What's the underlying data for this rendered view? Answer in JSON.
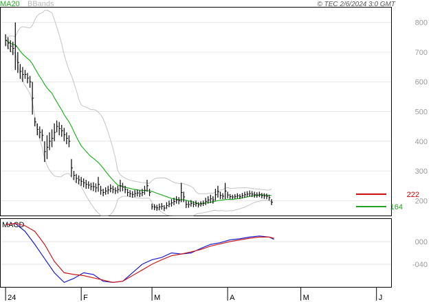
{
  "header": {
    "copyright": "© TEC 2/6/2024 3:0 GMT",
    "legend": [
      {
        "name": "MA20",
        "color": "#22b022"
      },
      {
        "name": "BBands",
        "color": "#b8b8b8"
      }
    ]
  },
  "chart_data": [
    {
      "type": "line",
      "panel": "price",
      "yticks": [
        "800",
        "700",
        "600",
        "500",
        "400",
        "300",
        "200"
      ],
      "ylim": [
        150,
        850
      ],
      "xticks": [
        {
          "label": "24",
          "day": 0
        },
        {
          "label": "F",
          "day": 31
        },
        {
          "label": "M",
          "day": 60
        },
        {
          "label": "A",
          "day": 91
        },
        {
          "label": "M",
          "day": 121
        },
        {
          "label": "J",
          "day": 152
        }
      ],
      "xlim": [
        -2,
        158
      ],
      "price_high_low": [
        {
          "day": 0,
          "high": 760,
          "low": 720
        },
        {
          "day": 1,
          "high": 750,
          "low": 710
        },
        {
          "day": 2,
          "high": 740,
          "low": 700
        },
        {
          "day": 3,
          "high": 735,
          "low": 690
        },
        {
          "day": 4,
          "high": 800,
          "low": 640
        },
        {
          "day": 5,
          "high": 700,
          "low": 630
        },
        {
          "day": 6,
          "high": 660,
          "low": 610
        },
        {
          "day": 7,
          "high": 650,
          "low": 600
        },
        {
          "day": 8,
          "high": 640,
          "low": 610
        },
        {
          "day": 9,
          "high": 630,
          "low": 595
        },
        {
          "day": 10,
          "high": 620,
          "low": 580
        },
        {
          "day": 11,
          "high": 600,
          "low": 490
        },
        {
          "day": 12,
          "high": 480,
          "low": 450
        },
        {
          "day": 13,
          "high": 460,
          "low": 420
        },
        {
          "day": 14,
          "high": 450,
          "low": 410
        },
        {
          "day": 15,
          "high": 440,
          "low": 400
        },
        {
          "day": 16,
          "high": 400,
          "low": 330
        },
        {
          "day": 17,
          "high": 420,
          "low": 340
        },
        {
          "day": 18,
          "high": 430,
          "low": 370
        },
        {
          "day": 19,
          "high": 440,
          "low": 380
        },
        {
          "day": 20,
          "high": 460,
          "low": 400
        },
        {
          "day": 21,
          "high": 470,
          "low": 430
        },
        {
          "day": 22,
          "high": 465,
          "low": 420
        },
        {
          "day": 23,
          "high": 455,
          "low": 415
        },
        {
          "day": 24,
          "high": 445,
          "low": 400
        },
        {
          "day": 25,
          "high": 430,
          "low": 390
        },
        {
          "day": 26,
          "high": 420,
          "low": 380
        },
        {
          "day": 27,
          "high": 340,
          "low": 280
        },
        {
          "day": 28,
          "high": 300,
          "low": 270
        },
        {
          "day": 29,
          "high": 290,
          "low": 260
        },
        {
          "day": 30,
          "high": 285,
          "low": 255
        },
        {
          "day": 31,
          "high": 280,
          "low": 250
        },
        {
          "day": 32,
          "high": 275,
          "low": 245
        },
        {
          "day": 33,
          "high": 270,
          "low": 240
        },
        {
          "day": 34,
          "high": 265,
          "low": 240
        },
        {
          "day": 35,
          "high": 260,
          "low": 235
        },
        {
          "day": 36,
          "high": 262,
          "low": 232
        },
        {
          "day": 37,
          "high": 258,
          "low": 228
        },
        {
          "day": 38,
          "high": 280,
          "low": 230
        },
        {
          "day": 39,
          "high": 250,
          "low": 220
        },
        {
          "day": 40,
          "high": 240,
          "low": 215
        },
        {
          "day": 41,
          "high": 245,
          "low": 220
        },
        {
          "day": 42,
          "high": 250,
          "low": 222
        },
        {
          "day": 43,
          "high": 255,
          "low": 228
        },
        {
          "day": 44,
          "high": 250,
          "low": 225
        },
        {
          "day": 45,
          "high": 245,
          "low": 222
        },
        {
          "day": 46,
          "high": 250,
          "low": 225
        },
        {
          "day": 47,
          "high": 270,
          "low": 230
        },
        {
          "day": 48,
          "high": 260,
          "low": 232
        },
        {
          "day": 49,
          "high": 250,
          "low": 225
        },
        {
          "day": 50,
          "high": 240,
          "low": 215
        },
        {
          "day": 51,
          "high": 235,
          "low": 212
        },
        {
          "day": 52,
          "high": 232,
          "low": 210
        },
        {
          "day": 53,
          "high": 236,
          "low": 212
        },
        {
          "day": 54,
          "high": 238,
          "low": 214
        },
        {
          "day": 55,
          "high": 235,
          "low": 212
        },
        {
          "day": 56,
          "high": 240,
          "low": 215
        },
        {
          "day": 57,
          "high": 250,
          "low": 220
        },
        {
          "day": 58,
          "high": 270,
          "low": 230
        },
        {
          "day": 59,
          "high": 240,
          "low": 215
        },
        {
          "day": 60,
          "high": 190,
          "low": 170
        },
        {
          "day": 61,
          "high": 188,
          "low": 168
        },
        {
          "day": 62,
          "high": 186,
          "low": 166
        },
        {
          "day": 63,
          "high": 190,
          "low": 168
        },
        {
          "day": 64,
          "high": 192,
          "low": 170
        },
        {
          "day": 65,
          "high": 185,
          "low": 165
        },
        {
          "day": 66,
          "high": 195,
          "low": 172
        },
        {
          "day": 67,
          "high": 200,
          "low": 178
        },
        {
          "day": 68,
          "high": 205,
          "low": 180
        },
        {
          "day": 69,
          "high": 210,
          "low": 185
        },
        {
          "day": 70,
          "high": 215,
          "low": 190
        },
        {
          "day": 71,
          "high": 212,
          "low": 188
        },
        {
          "day": 72,
          "high": 260,
          "low": 195
        },
        {
          "day": 73,
          "high": 230,
          "low": 195
        },
        {
          "day": 74,
          "high": 200,
          "low": 175
        },
        {
          "day": 75,
          "high": 198,
          "low": 176
        },
        {
          "day": 76,
          "high": 202,
          "low": 180
        },
        {
          "day": 77,
          "high": 198,
          "low": 178
        },
        {
          "day": 78,
          "high": 200,
          "low": 180
        },
        {
          "day": 79,
          "high": 195,
          "low": 177
        },
        {
          "day": 80,
          "high": 198,
          "low": 180
        },
        {
          "day": 81,
          "high": 200,
          "low": 182
        },
        {
          "day": 82,
          "high": 210,
          "low": 185
        },
        {
          "day": 83,
          "high": 215,
          "low": 190
        },
        {
          "day": 84,
          "high": 220,
          "low": 192
        },
        {
          "day": 85,
          "high": 215,
          "low": 190
        },
        {
          "day": 86,
          "high": 240,
          "low": 200
        },
        {
          "day": 87,
          "high": 250,
          "low": 210
        },
        {
          "day": 88,
          "high": 230,
          "low": 205
        },
        {
          "day": 89,
          "high": 225,
          "low": 205
        },
        {
          "day": 90,
          "high": 260,
          "low": 205
        },
        {
          "day": 91,
          "high": 230,
          "low": 208
        },
        {
          "day": 92,
          "high": 222,
          "low": 205
        },
        {
          "day": 93,
          "high": 220,
          "low": 205
        },
        {
          "day": 94,
          "high": 222,
          "low": 206
        },
        {
          "day": 95,
          "high": 225,
          "low": 208
        },
        {
          "day": 96,
          "high": 222,
          "low": 206
        },
        {
          "day": 97,
          "high": 226,
          "low": 208
        },
        {
          "day": 98,
          "high": 230,
          "low": 210
        },
        {
          "day": 99,
          "high": 232,
          "low": 212
        },
        {
          "day": 100,
          "high": 234,
          "low": 214
        },
        {
          "day": 101,
          "high": 232,
          "low": 212
        },
        {
          "day": 102,
          "high": 230,
          "low": 210
        },
        {
          "day": 103,
          "high": 228,
          "low": 210
        },
        {
          "day": 104,
          "high": 230,
          "low": 212
        },
        {
          "day": 105,
          "high": 226,
          "low": 208
        },
        {
          "day": 106,
          "high": 225,
          "low": 206
        },
        {
          "day": 107,
          "high": 224,
          "low": 205
        },
        {
          "day": 108,
          "high": 220,
          "low": 200
        },
        {
          "day": 109,
          "high": 205,
          "low": 185
        }
      ],
      "closing_markers": [
        {
          "label": "222",
          "value": 222,
          "color": "#cc0000"
        },
        {
          "label": "164",
          "value": 180,
          "color": "#22a022"
        }
      ]
    },
    {
      "type": "line",
      "panel": "macd",
      "title": "MACD",
      "yticks": [
        {
          "label": "000",
          "value": 0
        },
        {
          "label": "-040",
          "value": -40
        }
      ],
      "ylim": [
        -80,
        40
      ],
      "series": [
        {
          "name": "MACD",
          "color": "#1a1acc",
          "x": [
            0,
            4,
            8,
            12,
            16,
            20,
            24,
            28,
            32,
            36,
            40,
            44,
            48,
            52,
            56,
            60,
            64,
            68,
            72,
            76,
            80,
            84,
            88,
            92,
            96,
            100,
            104,
            108,
            110
          ],
          "y": [
            30,
            32,
            18,
            -5,
            -30,
            -55,
            -72,
            -65,
            -55,
            -58,
            -70,
            -72,
            -70,
            -55,
            -40,
            -32,
            -28,
            -20,
            -22,
            -20,
            -12,
            -5,
            -2,
            3,
            5,
            8,
            10,
            8,
            4
          ]
        },
        {
          "name": "Signal",
          "color": "#cc1a1a",
          "x": [
            0,
            4,
            8,
            12,
            16,
            20,
            24,
            28,
            32,
            36,
            40,
            44,
            48,
            52,
            56,
            60,
            64,
            68,
            72,
            76,
            80,
            84,
            88,
            92,
            96,
            100,
            104,
            108,
            110
          ],
          "y": [
            30,
            32,
            28,
            18,
            -5,
            -35,
            -55,
            -58,
            -60,
            -64,
            -68,
            -72,
            -70,
            -60,
            -50,
            -40,
            -32,
            -25,
            -22,
            -18,
            -14,
            -8,
            -4,
            0,
            3,
            6,
            8,
            8,
            6
          ]
        }
      ]
    }
  ]
}
